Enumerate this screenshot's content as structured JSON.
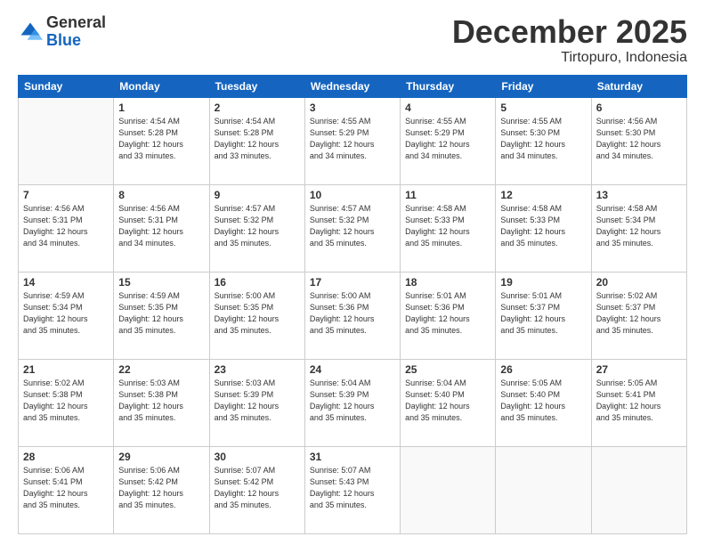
{
  "logo": {
    "general": "General",
    "blue": "Blue"
  },
  "title": {
    "month": "December 2025",
    "location": "Tirtopuro, Indonesia"
  },
  "headers": [
    "Sunday",
    "Monday",
    "Tuesday",
    "Wednesday",
    "Thursday",
    "Friday",
    "Saturday"
  ],
  "weeks": [
    [
      {
        "day": "",
        "info": ""
      },
      {
        "day": "1",
        "info": "Sunrise: 4:54 AM\nSunset: 5:28 PM\nDaylight: 12 hours\nand 33 minutes."
      },
      {
        "day": "2",
        "info": "Sunrise: 4:54 AM\nSunset: 5:28 PM\nDaylight: 12 hours\nand 33 minutes."
      },
      {
        "day": "3",
        "info": "Sunrise: 4:55 AM\nSunset: 5:29 PM\nDaylight: 12 hours\nand 34 minutes."
      },
      {
        "day": "4",
        "info": "Sunrise: 4:55 AM\nSunset: 5:29 PM\nDaylight: 12 hours\nand 34 minutes."
      },
      {
        "day": "5",
        "info": "Sunrise: 4:55 AM\nSunset: 5:30 PM\nDaylight: 12 hours\nand 34 minutes."
      },
      {
        "day": "6",
        "info": "Sunrise: 4:56 AM\nSunset: 5:30 PM\nDaylight: 12 hours\nand 34 minutes."
      }
    ],
    [
      {
        "day": "7",
        "info": "Sunrise: 4:56 AM\nSunset: 5:31 PM\nDaylight: 12 hours\nand 34 minutes."
      },
      {
        "day": "8",
        "info": "Sunrise: 4:56 AM\nSunset: 5:31 PM\nDaylight: 12 hours\nand 34 minutes."
      },
      {
        "day": "9",
        "info": "Sunrise: 4:57 AM\nSunset: 5:32 PM\nDaylight: 12 hours\nand 35 minutes."
      },
      {
        "day": "10",
        "info": "Sunrise: 4:57 AM\nSunset: 5:32 PM\nDaylight: 12 hours\nand 35 minutes."
      },
      {
        "day": "11",
        "info": "Sunrise: 4:58 AM\nSunset: 5:33 PM\nDaylight: 12 hours\nand 35 minutes."
      },
      {
        "day": "12",
        "info": "Sunrise: 4:58 AM\nSunset: 5:33 PM\nDaylight: 12 hours\nand 35 minutes."
      },
      {
        "day": "13",
        "info": "Sunrise: 4:58 AM\nSunset: 5:34 PM\nDaylight: 12 hours\nand 35 minutes."
      }
    ],
    [
      {
        "day": "14",
        "info": "Sunrise: 4:59 AM\nSunset: 5:34 PM\nDaylight: 12 hours\nand 35 minutes."
      },
      {
        "day": "15",
        "info": "Sunrise: 4:59 AM\nSunset: 5:35 PM\nDaylight: 12 hours\nand 35 minutes."
      },
      {
        "day": "16",
        "info": "Sunrise: 5:00 AM\nSunset: 5:35 PM\nDaylight: 12 hours\nand 35 minutes."
      },
      {
        "day": "17",
        "info": "Sunrise: 5:00 AM\nSunset: 5:36 PM\nDaylight: 12 hours\nand 35 minutes."
      },
      {
        "day": "18",
        "info": "Sunrise: 5:01 AM\nSunset: 5:36 PM\nDaylight: 12 hours\nand 35 minutes."
      },
      {
        "day": "19",
        "info": "Sunrise: 5:01 AM\nSunset: 5:37 PM\nDaylight: 12 hours\nand 35 minutes."
      },
      {
        "day": "20",
        "info": "Sunrise: 5:02 AM\nSunset: 5:37 PM\nDaylight: 12 hours\nand 35 minutes."
      }
    ],
    [
      {
        "day": "21",
        "info": "Sunrise: 5:02 AM\nSunset: 5:38 PM\nDaylight: 12 hours\nand 35 minutes."
      },
      {
        "day": "22",
        "info": "Sunrise: 5:03 AM\nSunset: 5:38 PM\nDaylight: 12 hours\nand 35 minutes."
      },
      {
        "day": "23",
        "info": "Sunrise: 5:03 AM\nSunset: 5:39 PM\nDaylight: 12 hours\nand 35 minutes."
      },
      {
        "day": "24",
        "info": "Sunrise: 5:04 AM\nSunset: 5:39 PM\nDaylight: 12 hours\nand 35 minutes."
      },
      {
        "day": "25",
        "info": "Sunrise: 5:04 AM\nSunset: 5:40 PM\nDaylight: 12 hours\nand 35 minutes."
      },
      {
        "day": "26",
        "info": "Sunrise: 5:05 AM\nSunset: 5:40 PM\nDaylight: 12 hours\nand 35 minutes."
      },
      {
        "day": "27",
        "info": "Sunrise: 5:05 AM\nSunset: 5:41 PM\nDaylight: 12 hours\nand 35 minutes."
      }
    ],
    [
      {
        "day": "28",
        "info": "Sunrise: 5:06 AM\nSunset: 5:41 PM\nDaylight: 12 hours\nand 35 minutes."
      },
      {
        "day": "29",
        "info": "Sunrise: 5:06 AM\nSunset: 5:42 PM\nDaylight: 12 hours\nand 35 minutes."
      },
      {
        "day": "30",
        "info": "Sunrise: 5:07 AM\nSunset: 5:42 PM\nDaylight: 12 hours\nand 35 minutes."
      },
      {
        "day": "31",
        "info": "Sunrise: 5:07 AM\nSunset: 5:43 PM\nDaylight: 12 hours\nand 35 minutes."
      },
      {
        "day": "",
        "info": ""
      },
      {
        "day": "",
        "info": ""
      },
      {
        "day": "",
        "info": ""
      }
    ]
  ]
}
